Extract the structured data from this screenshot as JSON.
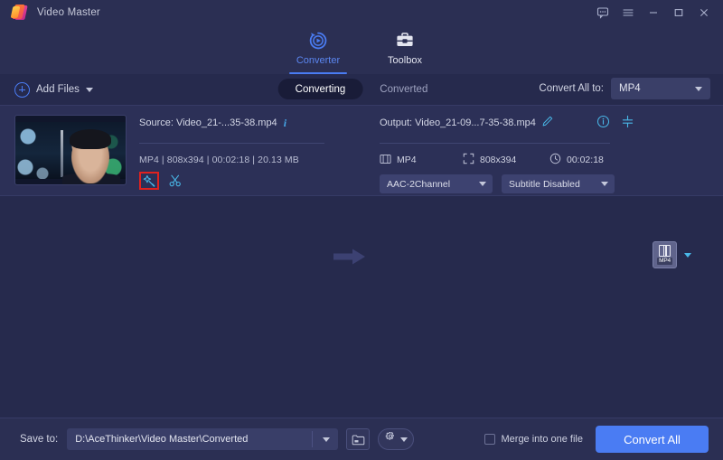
{
  "window": {
    "app_title": "Video Master",
    "controls": [
      {
        "name": "feedback-icon",
        "label": "feedback"
      },
      {
        "name": "menu-icon",
        "label": "menu"
      },
      {
        "name": "minimize-icon",
        "label": "minimize"
      },
      {
        "name": "maximize-icon",
        "label": "maximize"
      },
      {
        "name": "close-icon",
        "label": "close"
      }
    ]
  },
  "nav": {
    "tabs": [
      {
        "label": "Converter",
        "icon": "converter-icon",
        "active": true
      },
      {
        "label": "Toolbox",
        "icon": "toolbox-icon",
        "active": false
      }
    ]
  },
  "toolbar": {
    "add_files_label": "Add Files",
    "segments": [
      {
        "label": "Converting",
        "active": true
      },
      {
        "label": "Converted",
        "active": false
      }
    ],
    "convert_all_to_label": "Convert All to:",
    "convert_all_to_value": "MP4"
  },
  "file_card": {
    "source_label": "Source: Video_21-...35-38.mp4",
    "source_meta": "MP4 | 808x394 | 00:02:18 | 20.13 MB",
    "actions": [
      {
        "name": "edit-wand-icon",
        "highlighted": true
      },
      {
        "name": "trim-scissors-icon",
        "highlighted": false
      }
    ],
    "output_label": "Output: Video_21-09...7-35-38.mp4",
    "output_format": "MP4",
    "output_resolution": "808x394",
    "output_duration": "00:02:18",
    "audio_track": "AAC-2Channel",
    "subtitle_track": "Subtitle Disabled",
    "format_badge": "MP4"
  },
  "bottom": {
    "save_to_label": "Save to:",
    "save_to_path": "D:\\AceThinker\\Video Master\\Converted",
    "merge_label": "Merge into one file",
    "merge_checked": false,
    "convert_all_label": "Convert All"
  },
  "colors": {
    "accent_blue": "#4a7cf3",
    "cyan": "#49b8e8",
    "highlight_red": "#e0221f",
    "bg_main": "#262a4d",
    "bg_panel": "#2b2f53",
    "bg_card": "#2c3057"
  }
}
